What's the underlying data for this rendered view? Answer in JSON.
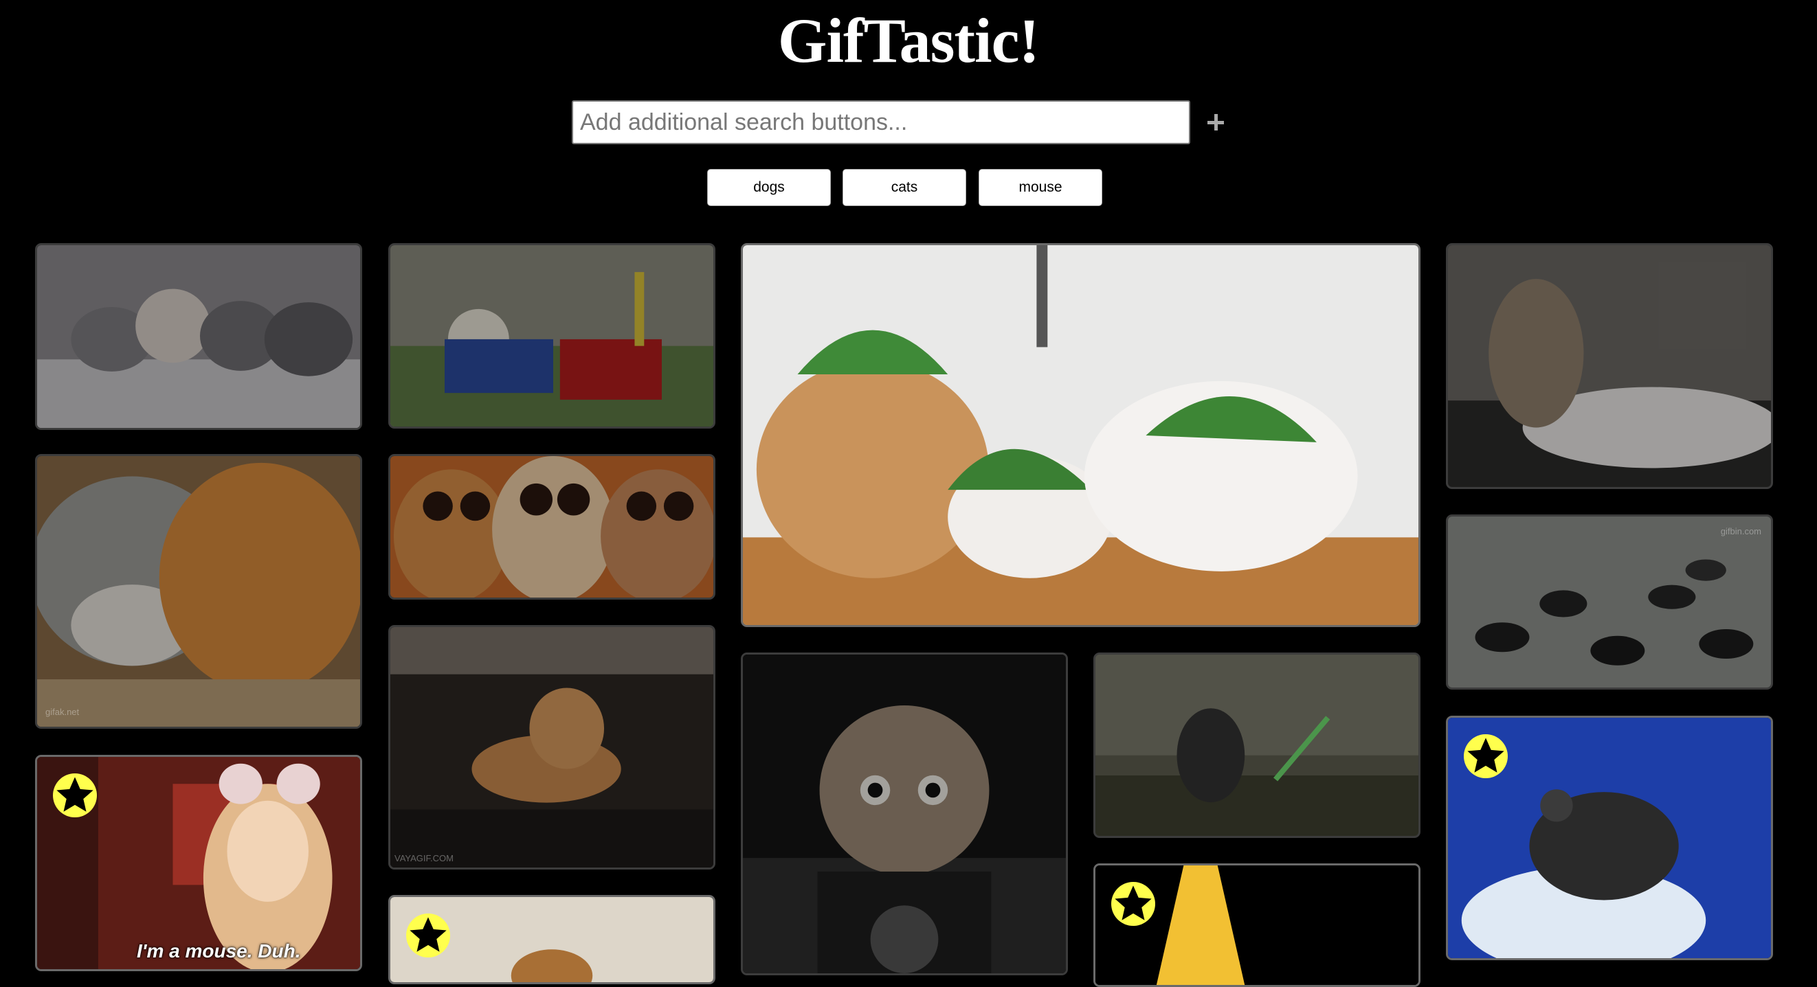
{
  "app": {
    "title": "GifTastic!"
  },
  "search": {
    "placeholder": "Add additional search buttons...",
    "add_icon": "plus-icon"
  },
  "topics": [
    "dogs",
    "cats",
    "mouse"
  ],
  "gifs": [
    {
      "id": "gif-cats-kittens-row",
      "favorited": false
    },
    {
      "id": "gif-cat-toy-piano",
      "favorited": false
    },
    {
      "id": "gif-cats-watermelon-helmets",
      "favorited": false
    },
    {
      "id": "gif-kitten-on-white-cat",
      "favorited": false
    },
    {
      "id": "gif-cats-cuddling",
      "favorited": false,
      "watermark": "gifak.net"
    },
    {
      "id": "gif-cartoon-kittens",
      "favorited": false
    },
    {
      "id": "gif-cats-on-sofa",
      "favorited": false,
      "watermark": "VAYAGIF.COM"
    },
    {
      "id": "gif-cats-walking-room",
      "favorited": false,
      "watermark": "gifbin.com"
    },
    {
      "id": "gif-mouse-costume-girl",
      "favorited": true,
      "caption": "I'm a mouse. Duh."
    },
    {
      "id": "gif-kitten-motorcycle",
      "favorited": false
    },
    {
      "id": "gif-cat-lightsaber",
      "favorited": false
    },
    {
      "id": "gif-black-mouse-blue",
      "favorited": true
    },
    {
      "id": "gif-hamster",
      "favorited": true
    },
    {
      "id": "gif-spotlight-yellow",
      "favorited": true
    }
  ],
  "icons": {
    "favorite": "star-icon"
  },
  "colors": {
    "background": "#000000",
    "favorite_badge": "#ffff4d",
    "card_border": "#3c3c3c"
  }
}
